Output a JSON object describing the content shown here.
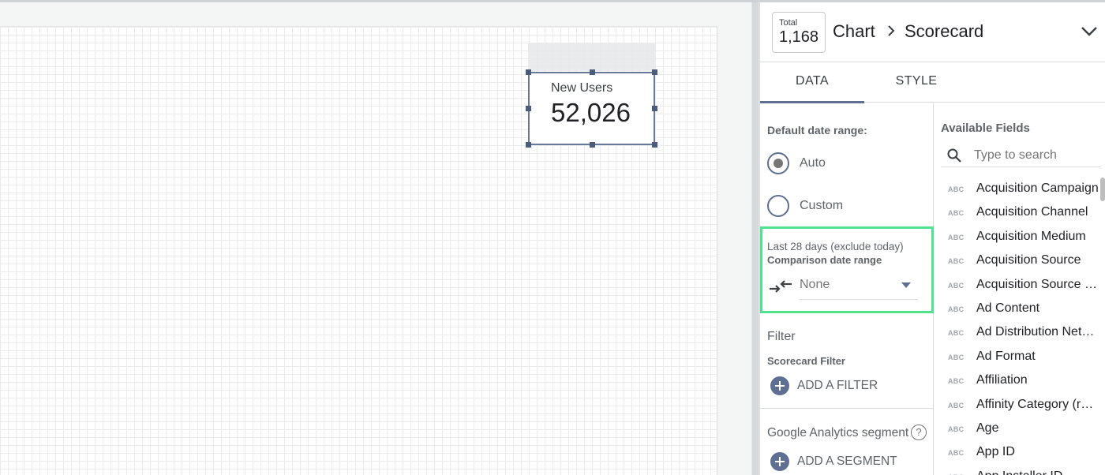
{
  "canvas": {
    "scorecard": {
      "label": "New Users",
      "value": "52,026"
    }
  },
  "panel": {
    "thumbnail": {
      "label": "Total",
      "value": "1,168"
    },
    "breadcrumb": {
      "chart": "Chart",
      "type": "Scorecard"
    },
    "tabs": [
      {
        "label": "DATA",
        "active": true
      },
      {
        "label": "STYLE",
        "active": false
      }
    ],
    "date_range": {
      "title": "Default date range:",
      "options": [
        {
          "label": "Auto",
          "selected": true
        },
        {
          "label": "Custom",
          "selected": false
        }
      ],
      "summary": "Last 28 days (exclude today)",
      "comparison_title": "Comparison date range",
      "comparison_value": "None"
    },
    "filter": {
      "title": "Filter",
      "subtitle": "Scorecard Filter",
      "add_label": "ADD A FILTER"
    },
    "segment": {
      "title": "Google Analytics segment",
      "help": "?",
      "add_label": "ADD A SEGMENT"
    },
    "fields": {
      "title": "Available Fields",
      "search_placeholder": "Type to search",
      "items": [
        {
          "type": "ABC",
          "name": "Acquisition Campaign"
        },
        {
          "type": "ABC",
          "name": "Acquisition Channel"
        },
        {
          "type": "ABC",
          "name": "Acquisition Medium"
        },
        {
          "type": "ABC",
          "name": "Acquisition Source"
        },
        {
          "type": "ABC",
          "name": "Acquisition Source / ..."
        },
        {
          "type": "ABC",
          "name": "Ad Content"
        },
        {
          "type": "ABC",
          "name": "Ad Distribution Netwo..."
        },
        {
          "type": "ABC",
          "name": "Ad Format"
        },
        {
          "type": "ABC",
          "name": "Affiliation"
        },
        {
          "type": "ABC",
          "name": "Affinity Category (reac..."
        },
        {
          "type": "ABC",
          "name": "Age"
        },
        {
          "type": "ABC",
          "name": "App ID"
        },
        {
          "type": "ABC",
          "name": "App Installer ID"
        }
      ]
    }
  },
  "colors": {
    "accent": "#5f6f94",
    "highlight": "#4fe38f",
    "selection": "#66799a"
  }
}
